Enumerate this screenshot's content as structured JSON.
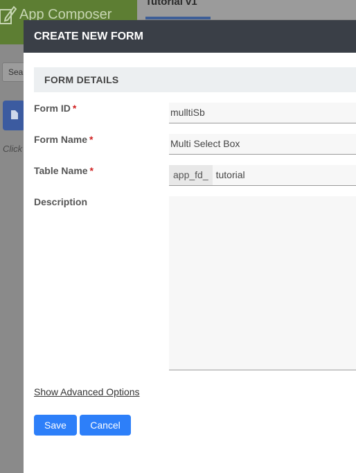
{
  "background": {
    "app_title": "App Composer",
    "breadcrumb": "Tutorial v1",
    "search_placeholder": "Search",
    "search_visible": "Sear",
    "hint_text": "Click"
  },
  "modal": {
    "title": "CREATE NEW FORM",
    "section_title": "FORM DETAILS",
    "fields": {
      "form_id": {
        "label": "Form ID",
        "value": "mulltiSb",
        "required": "*"
      },
      "form_name": {
        "label": "Form Name",
        "value": "Multi Select Box",
        "required": "*"
      },
      "table_name": {
        "label": "Table Name",
        "prefix": "app_fd_",
        "value": "tutorial",
        "required": "*"
      },
      "description": {
        "label": "Description",
        "value": ""
      }
    },
    "advanced_link": "Show Advanced Options",
    "save_label": "Save",
    "cancel_label": "Cancel"
  },
  "colors": {
    "header_bg": "#3a3f47",
    "button_bg": "#2d7ff9",
    "required": "#d02020",
    "app_header_bg": "#5d7e33"
  }
}
